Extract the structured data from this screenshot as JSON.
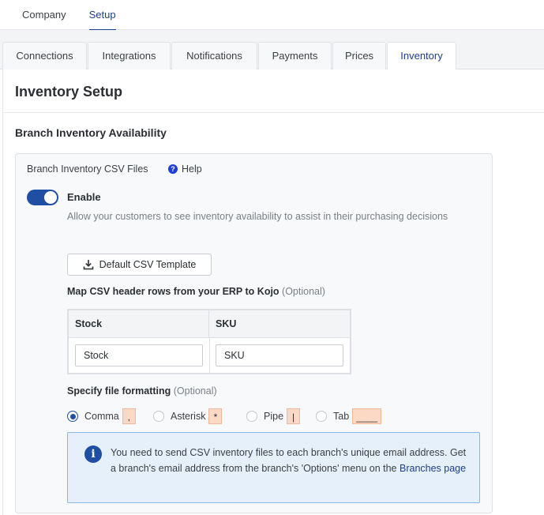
{
  "top_tabs": {
    "company": "Company",
    "setup": "Setup"
  },
  "sub_tabs": [
    "Connections",
    "Integrations",
    "Notifications",
    "Payments",
    "Prices",
    "Inventory"
  ],
  "active_sub_tab": "Inventory",
  "page": {
    "title": "Inventory Setup",
    "section_title": "Branch Inventory Availability"
  },
  "card": {
    "title": "Branch Inventory CSV Files",
    "help_icon": "?",
    "help_label": "Help",
    "toggle_on": true,
    "enable_label": "Enable",
    "enable_description": "Allow your customers to see inventory availability to assist in their purchasing decisions",
    "template_button": "Default CSV Template",
    "map_label": "Map CSV header rows from your ERP to Kojo",
    "map_optional": "(Optional)",
    "map_columns": [
      "Stock",
      "SKU"
    ],
    "map_values": [
      "Stock",
      "SKU"
    ],
    "format_label": "Specify file formatting",
    "format_optional": "(Optional)",
    "formats": [
      {
        "label": "Comma",
        "symbol": ",",
        "checked": true
      },
      {
        "label": "Asterisk",
        "symbol": "*",
        "checked": false
      },
      {
        "label": "Pipe",
        "symbol": "|",
        "checked": false
      },
      {
        "label": "Tab",
        "symbol": "____",
        "checked": false
      }
    ],
    "info_icon": "i",
    "info_text": "You need to send CSV inventory files to each branch's unique email address. Get a branch's email address from the branch's 'Options' menu on the",
    "info_link": "Branches page"
  },
  "colors": {
    "accent": "#1d3f8c",
    "toggle": "#1f4fa3",
    "chip_bg": "#fcd9c4",
    "info_bg": "#e6f0fa"
  }
}
